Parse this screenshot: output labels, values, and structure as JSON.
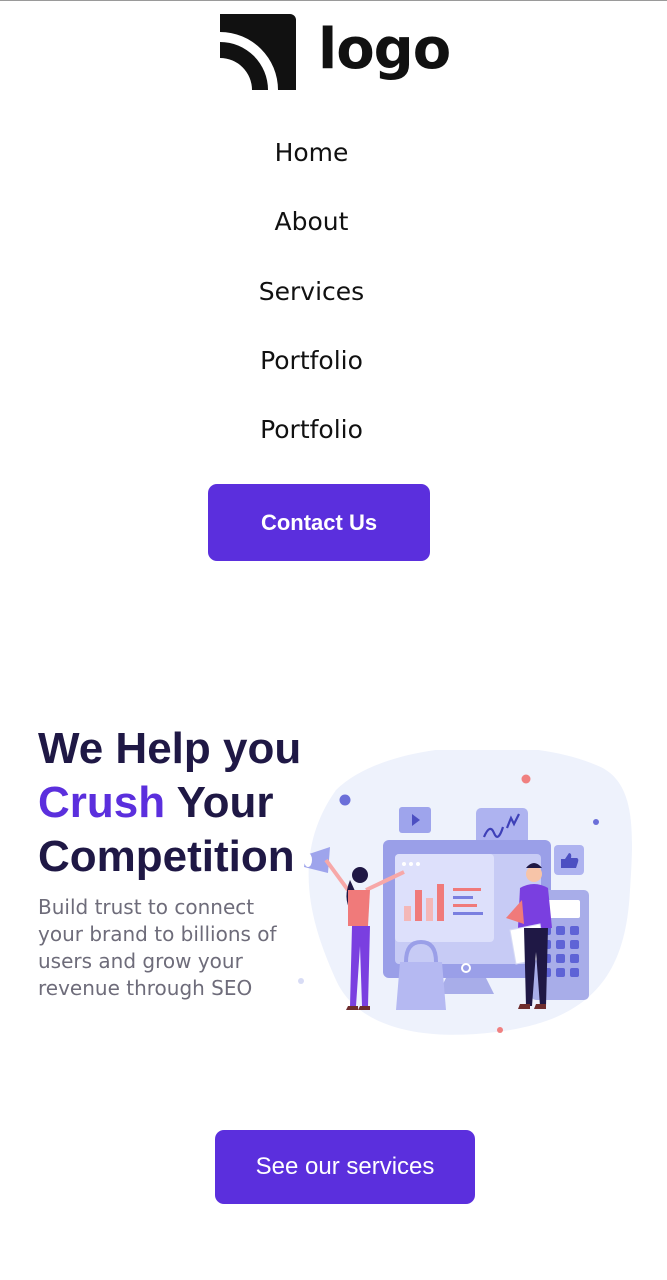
{
  "logo": {
    "text": "logo"
  },
  "nav": {
    "items": [
      {
        "label": "Home"
      },
      {
        "label": "About"
      },
      {
        "label": "Services"
      },
      {
        "label": "Portfolio"
      },
      {
        "label": "Portfolio"
      }
    ],
    "contact_label": "Contact Us"
  },
  "hero": {
    "title_line1": "We Help you",
    "title_accent": "Crush",
    "title_rest": "Your",
    "title_line3": "Competition",
    "description": "Build trust to connect your brand to billions of users and grow your revenue through SEO",
    "cta_label": "See our services"
  },
  "colors": {
    "accent": "#5b2fdd",
    "heading": "#1f1845",
    "body_text": "#6e6c7a",
    "illustration_blob": "#eef2fc"
  }
}
